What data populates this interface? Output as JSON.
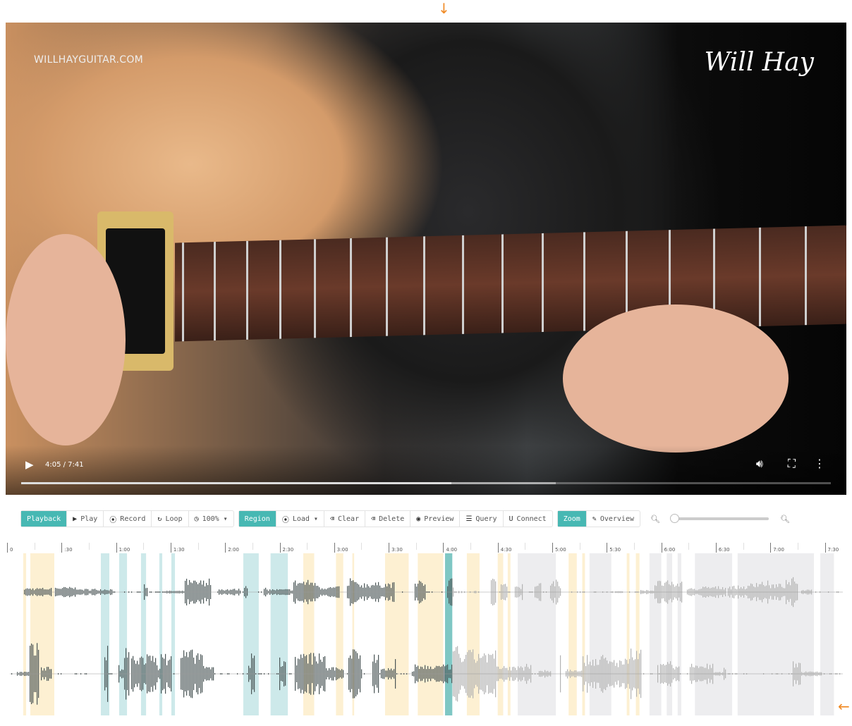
{
  "video": {
    "watermark": "WILLHAYGUITAR.COM",
    "logo": "Will Hay",
    "time": "4:05 / 7:41",
    "current_seconds": 245,
    "duration_seconds": 461,
    "buffered_fraction": 0.66,
    "icons": [
      "play-icon",
      "volume-icon",
      "fullscreen-icon",
      "more-vert-icon"
    ]
  },
  "toolbar": {
    "playback": {
      "label": "Playback",
      "items": [
        {
          "icon": "play-icon",
          "glyph": "▶",
          "label": "Play"
        },
        {
          "icon": "record-icon",
          "glyph": "⦿",
          "label": "Record"
        },
        {
          "icon": "loop-icon",
          "glyph": "↻",
          "label": "Loop"
        },
        {
          "icon": "clock-icon",
          "glyph": "◷",
          "label": "100% ▾"
        }
      ]
    },
    "region": {
      "label": "Region",
      "items": [
        {
          "icon": "load-icon",
          "glyph": "⦿",
          "label": "Load ▾"
        },
        {
          "icon": "clear-icon",
          "glyph": "⌫",
          "label": "Clear"
        },
        {
          "icon": "delete-icon",
          "glyph": "⌫",
          "label": "Delete"
        },
        {
          "icon": "eye-icon",
          "glyph": "◉",
          "label": "Preview"
        },
        {
          "icon": "query-icon",
          "glyph": "☰",
          "label": "Query"
        },
        {
          "icon": "magnet-icon",
          "glyph": "U",
          "label": "Connect"
        }
      ]
    },
    "zoom": {
      "label": "Zoom",
      "items": [
        {
          "icon": "pencil-icon",
          "glyph": "✎",
          "label": "Overview"
        }
      ]
    },
    "zoom_level": 0
  },
  "timeline": {
    "ticks": [
      "0",
      ":30",
      "1:00",
      "1:30",
      "2:00",
      "2:30",
      "3:00",
      "3:30",
      "4:00",
      "4:30",
      "5:00",
      "5:30",
      "6:00",
      "6:30",
      "7:00",
      "7:30"
    ],
    "tick_interval_seconds": 30,
    "playhead_seconds": 245,
    "colors": {
      "yellow": "#fdf0d2",
      "teal": "#cde9ea",
      "gray": "#ededef",
      "current": "#7fc7c4",
      "wave_dark": "#4a5556",
      "wave_light": "#b3b3b3",
      "arrow": "#f08a24"
    },
    "regions": [
      {
        "type": "yellow",
        "start": 8.9,
        "end": 10.5
      },
      {
        "type": "yellow",
        "start": 12.8,
        "end": 26
      },
      {
        "type": "teal",
        "start": 51.6,
        "end": 56.3
      },
      {
        "type": "teal",
        "start": 61.7,
        "end": 66
      },
      {
        "type": "teal",
        "start": 73.7,
        "end": 76.5
      },
      {
        "type": "teal",
        "start": 83.8,
        "end": 85.4
      },
      {
        "type": "teal",
        "start": 90.4,
        "end": 92.4
      },
      {
        "type": "teal",
        "start": 130,
        "end": 138.5
      },
      {
        "type": "teal",
        "start": 145,
        "end": 154.5
      },
      {
        "type": "yellow",
        "start": 163,
        "end": 169
      },
      {
        "type": "yellow",
        "start": 181,
        "end": 185
      },
      {
        "type": "yellow",
        "start": 190,
        "end": 191
      },
      {
        "type": "yellow",
        "start": 208,
        "end": 221
      },
      {
        "type": "yellow",
        "start": 226,
        "end": 240
      },
      {
        "type": "current",
        "start": 241,
        "end": 245
      },
      {
        "type": "yellow",
        "start": 253,
        "end": 260
      },
      {
        "type": "yellow",
        "start": 270,
        "end": 273
      },
      {
        "type": "yellow",
        "start": 275.5,
        "end": 277
      },
      {
        "type": "gray",
        "start": 281,
        "end": 302
      },
      {
        "type": "yellow",
        "start": 309,
        "end": 313.5
      },
      {
        "type": "yellow",
        "start": 316.5,
        "end": 318
      },
      {
        "type": "gray",
        "start": 320.5,
        "end": 332.5
      },
      {
        "type": "yellow",
        "start": 341,
        "end": 342.5
      },
      {
        "type": "yellow",
        "start": 346,
        "end": 348
      },
      {
        "type": "gray",
        "start": 353.5,
        "end": 360
      },
      {
        "type": "gray",
        "start": 363,
        "end": 366
      },
      {
        "type": "gray",
        "start": 369,
        "end": 371
      },
      {
        "type": "gray",
        "start": 378.5,
        "end": 399
      },
      {
        "type": "gray",
        "start": 402,
        "end": 444
      },
      {
        "type": "gray",
        "start": 447.5,
        "end": 455
      }
    ]
  }
}
